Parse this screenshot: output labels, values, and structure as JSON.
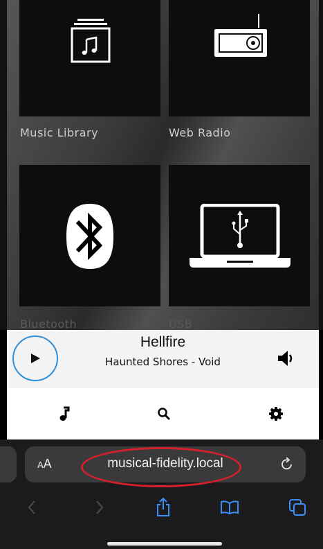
{
  "tiles": [
    {
      "label": "Music Library",
      "icon": "music-library-icon"
    },
    {
      "label": "Web Radio",
      "icon": "radio-icon"
    },
    {
      "label": "Bluetooth",
      "icon": "bluetooth-icon"
    },
    {
      "label": "USB",
      "icon": "laptop-usb-icon"
    }
  ],
  "now_playing": {
    "title": "Hellfire",
    "subtitle": "Haunted Shores - Void",
    "play_icon": "play-icon",
    "volume_icon": "speaker-icon"
  },
  "toolbar": {
    "items": [
      {
        "icon": "music-note-icon"
      },
      {
        "icon": "search-icon"
      },
      {
        "icon": "gear-icon"
      }
    ]
  },
  "browser": {
    "text_size_label_small": "A",
    "text_size_label_large": "A",
    "url": "musical-fidelity.local",
    "reload_icon": "reload-icon",
    "nav": [
      "back-icon",
      "forward-icon",
      "share-icon",
      "bookmarks-icon",
      "tabs-icon"
    ]
  },
  "colors": {
    "accent_blue": "#2f8fd8",
    "highlight_red": "#d3202a",
    "tile_bg": "#0d0d0d"
  }
}
